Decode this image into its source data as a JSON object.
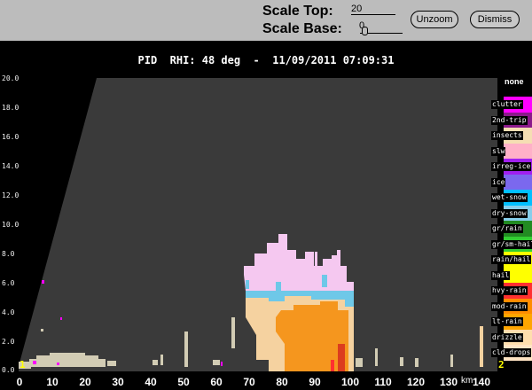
{
  "controls": {
    "scale_top_label": "Scale Top:",
    "scale_top_value": "20",
    "scale_base_label": "Scale Base:",
    "scale_base_value": "0",
    "unzoom_label": "Unzoom",
    "dismiss_label": "Dismiss"
  },
  "plot": {
    "title": "PID  RHI: 48 deg  -  11/09/2011 07:09:31",
    "x_ticks": [
      "0",
      "10",
      "20",
      "30",
      "40",
      "50",
      "60",
      "70",
      "80",
      "90",
      "100",
      "110",
      "120",
      "130",
      "140"
    ],
    "x_unit": "km",
    "y_ticks": [
      "0.0",
      "2.0",
      "4.0",
      "6.0",
      "8.0",
      "10.0",
      "12.0",
      "14.0",
      "16.0",
      "18.0",
      "20.0"
    ],
    "corner_left": "1",
    "corner_right": "2"
  },
  "legend": {
    "none_label": "none",
    "items": [
      {
        "label": "clutter",
        "color": "#ff00ff"
      },
      {
        "label": "2nd-trip",
        "color": "#8b1a8b"
      },
      {
        "label": "insects",
        "color": "#f5deb3"
      },
      {
        "label": "slw",
        "color": "#ffb0c8"
      },
      {
        "label": "irreg-ice",
        "color": "#a020f0"
      },
      {
        "label": "ice",
        "color": "#7b68ee"
      },
      {
        "label": "wet-snow",
        "color": "#00bfff"
      },
      {
        "label": "dry-snow",
        "color": "#87ceeb"
      },
      {
        "label": "gr/rain",
        "color": "#228b22"
      },
      {
        "label": "gr/sm-hail",
        "color": "#32cd32"
      },
      {
        "label": "rain/hail",
        "color": "#ffff00"
      },
      {
        "label": "hail",
        "color": "#ffff00"
      },
      {
        "label": "hvy-rain",
        "color": "#ff3030"
      },
      {
        "label": "mod-rain",
        "color": "#ff8c00"
      },
      {
        "label": "lt-rain",
        "color": "#ffa500"
      },
      {
        "label": "drizzle",
        "color": "#ffdead"
      },
      {
        "label": "cld-drops",
        "color": "#ffe4c4"
      }
    ]
  },
  "colors": {
    "cloud_pink": "#f5c8f0",
    "snow_blue": "#6ec8e8",
    "rain_orange": "#f5961e",
    "drizzle_tan": "#f5d2a0",
    "insects_gray": "#d2ccb4",
    "hail_red": "#dc3c1e"
  }
}
